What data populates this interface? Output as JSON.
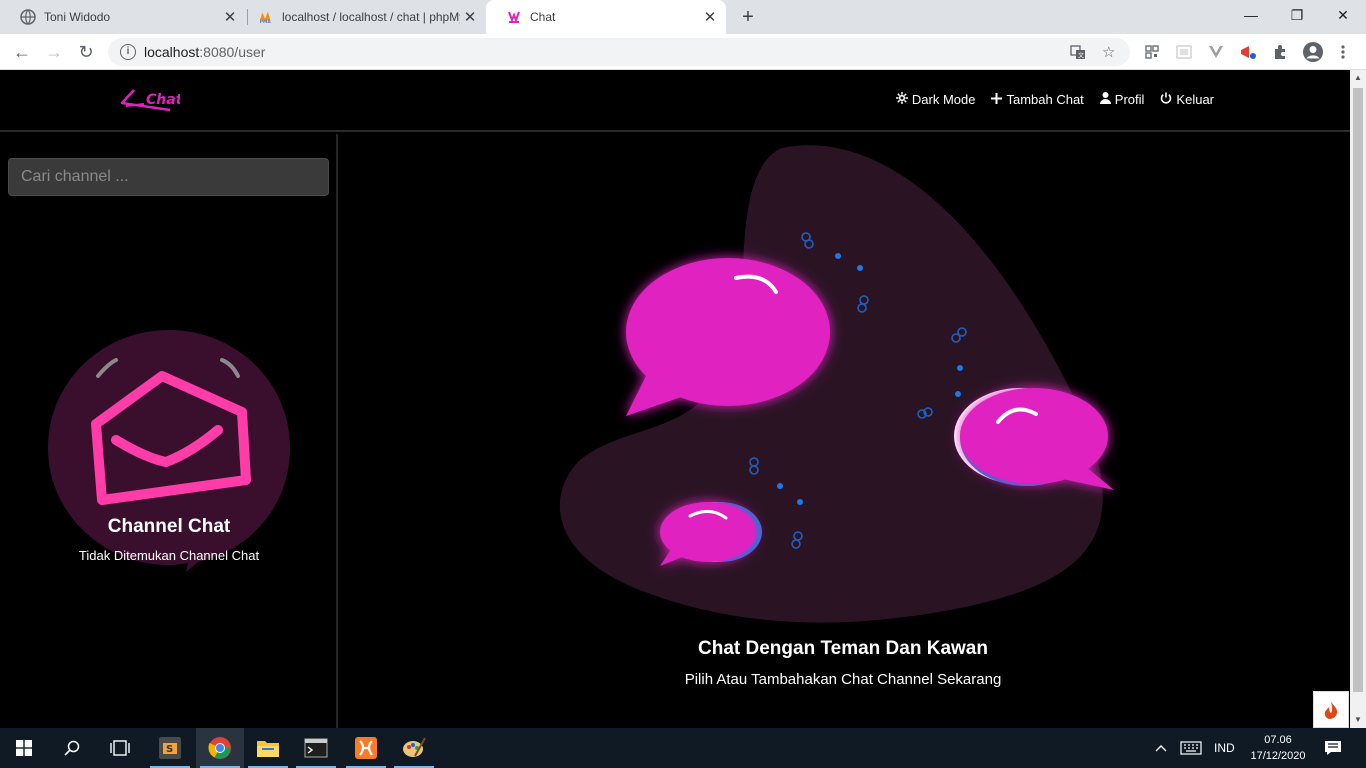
{
  "browser": {
    "tabs": [
      {
        "title": "Toni Widodo",
        "icon": "globe-icon"
      },
      {
        "title": "localhost / localhost / chat | phpMyAdmin",
        "icon": "phpmyadmin-icon"
      },
      {
        "title": "Chat",
        "icon": "chat-logo-icon"
      }
    ],
    "url_host": "localhost",
    "url_rest": ":8080/user"
  },
  "app": {
    "brand": "Chat",
    "nav": [
      {
        "label": "Dark Mode",
        "icon": "gear-icon"
      },
      {
        "label": "Tambah Chat",
        "icon": "plus-icon"
      },
      {
        "label": "Profil",
        "icon": "user-icon"
      },
      {
        "label": "Keluar",
        "icon": "power-icon"
      }
    ],
    "search_placeholder": "Cari channel ...",
    "sidebar_title": "Channel Chat",
    "sidebar_sub": "Tidak Ditemukan Channel Chat",
    "main_title": "Chat Dengan Teman Dan Kawan",
    "main_sub": "Pilih Atau Tambahakan Chat Channel Sekarang"
  },
  "taskbar": {
    "lang": "IND",
    "time": "07.06",
    "date": "17/12/2020"
  },
  "colors": {
    "accent": "#e020c0",
    "blob": "#2a1424",
    "dark_blob": "#3a0f2e",
    "envelope": "#ff3ca8"
  }
}
